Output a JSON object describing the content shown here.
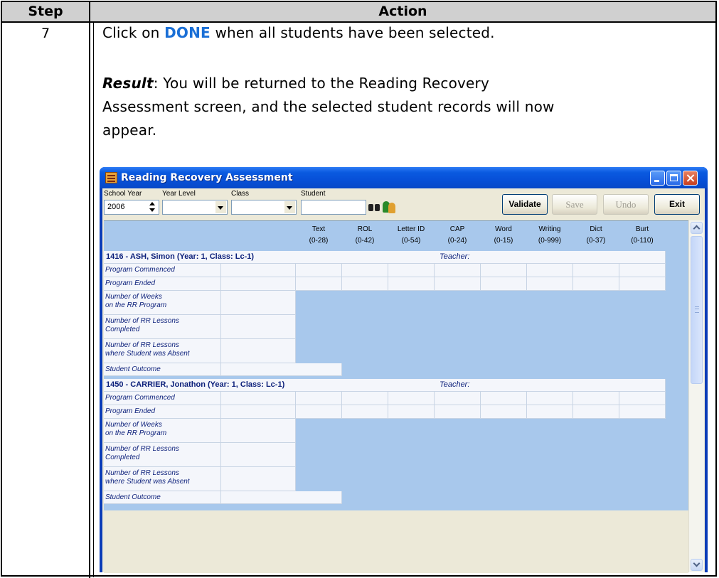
{
  "doc": {
    "header_step": "Step",
    "header_action": "Action",
    "step_number": "7",
    "line1_pre": "Click on ",
    "line1_done": "DONE",
    "line1_post": " when all students have been selected.",
    "result_label": "Result",
    "result_line1": ": You will be returned to the Reading Recovery",
    "result_line2": "Assessment screen, and the selected student records will now",
    "result_line3": "appear."
  },
  "window": {
    "title": "Reading Recovery Assessment",
    "labels": {
      "school_year": "School Year",
      "year_level": "Year Level",
      "class": "Class",
      "student": "Student"
    },
    "school_year_value": "2006",
    "year_level_value": "",
    "class_value": "",
    "student_value": "",
    "buttons": {
      "validate": "Validate",
      "save": "Save",
      "undo": "Undo",
      "exit": "Exit"
    }
  },
  "grid": {
    "columns": [
      {
        "name": "Text",
        "range": "(0-28)"
      },
      {
        "name": "ROL",
        "range": "(0-42)"
      },
      {
        "name": "Letter ID",
        "range": "(0-54)"
      },
      {
        "name": "CAP",
        "range": "(0-24)"
      },
      {
        "name": "Word",
        "range": "(0-15)"
      },
      {
        "name": "Writing",
        "range": "(0-999)"
      },
      {
        "name": "Dict",
        "range": "(0-37)"
      },
      {
        "name": "Burt",
        "range": "(0-110)"
      }
    ],
    "teacher_label": "Teacher:",
    "row_labels": {
      "program_commenced": "Program Commenced",
      "program_ended": "Program Ended",
      "weeks_1": "Number of Weeks",
      "weeks_2": "on the RR Program",
      "lessons_1": "Number of RR Lessons",
      "lessons_2": "Completed",
      "absent_1": "Number of RR Lessons",
      "absent_2": "where Student was Absent",
      "outcome": "Student Outcome"
    },
    "students": [
      {
        "header": "1416 - ASH, Simon  (Year: 1,  Class: Lc-1)"
      },
      {
        "header": "1450 - CARRIER, Jonathon  (Year: 1,  Class: Lc-1)"
      }
    ]
  }
}
